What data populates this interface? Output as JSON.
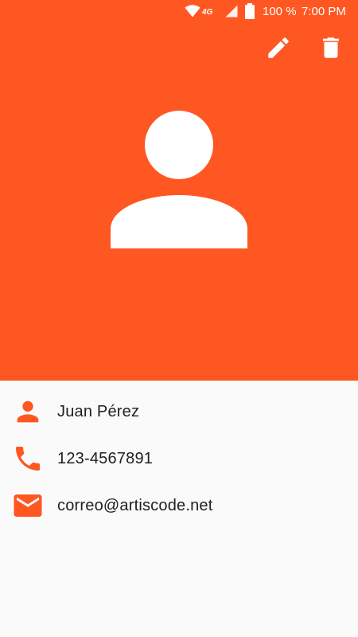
{
  "colors": {
    "accent": "#ff5722",
    "background": "#fafafa",
    "text": "#212121",
    "icon_on_accent": "#ffffff"
  },
  "status_bar": {
    "network_type": "4G",
    "battery": "100 %",
    "time": "7:00 PM",
    "icons": [
      "wifi-icon",
      "signal-icon",
      "battery-icon"
    ]
  },
  "toolbar": {
    "actions": [
      "edit-icon",
      "delete-icon"
    ]
  },
  "contact": {
    "avatar_icon": "person-icon",
    "name": "Juan Pérez",
    "phone": "123-4567891",
    "email": "correo@artiscode.net",
    "field_icons": [
      "person-icon",
      "phone-icon",
      "email-icon"
    ]
  }
}
